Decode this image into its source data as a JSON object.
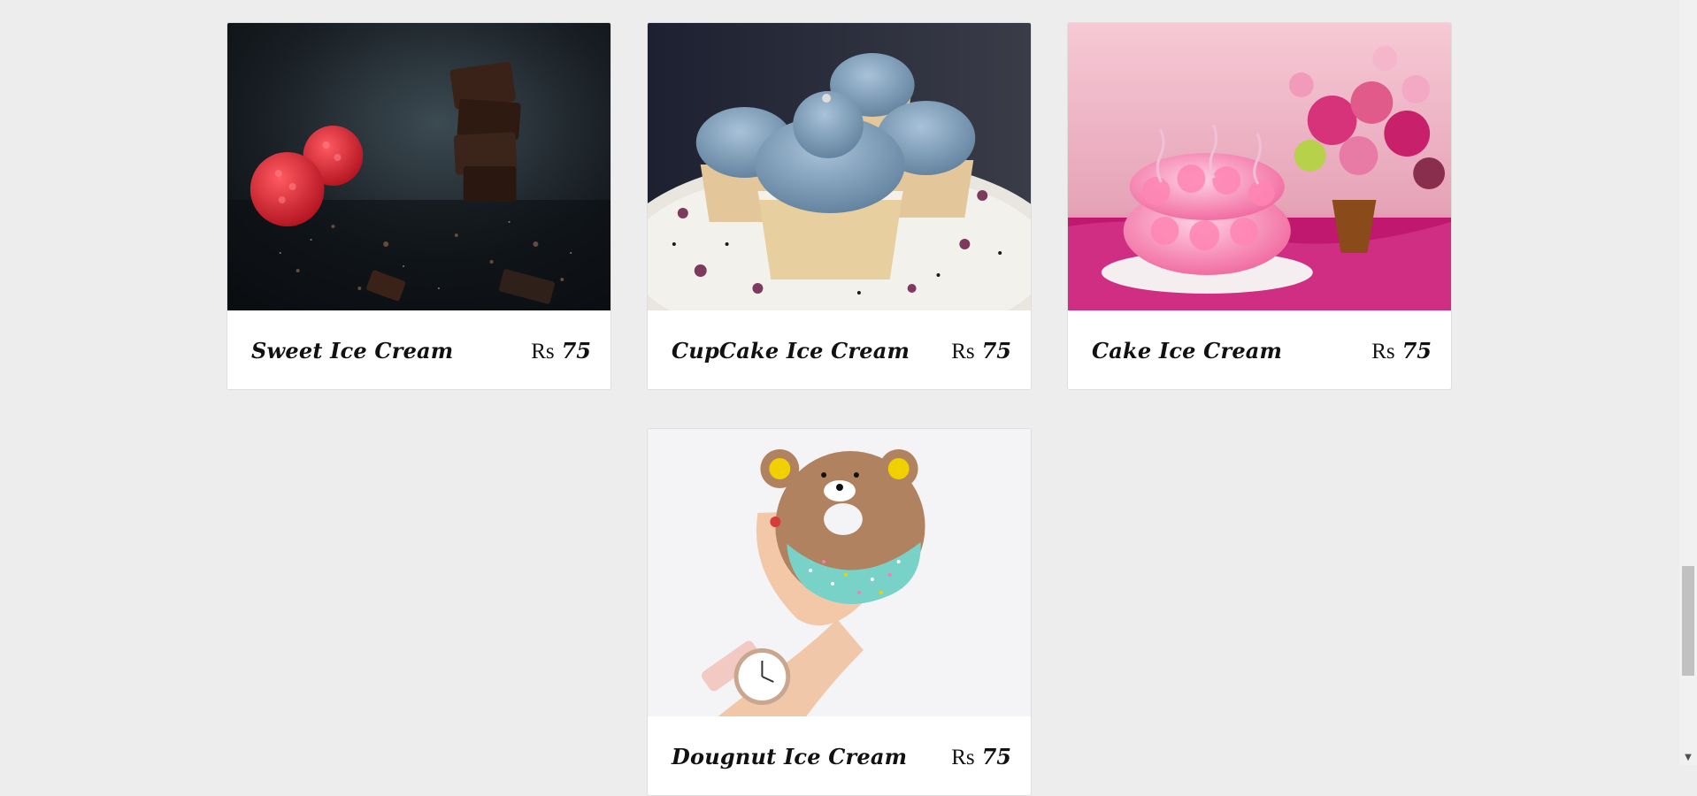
{
  "products": [
    {
      "name": "Sweet Ice Cream",
      "currency": "Rs",
      "price": "75",
      "image_icon": "chocolate-raspberry-photo"
    },
    {
      "name": "CupCake Ice Cream",
      "currency": "Rs",
      "price": "75",
      "image_icon": "blue-cupcakes-photo"
    },
    {
      "name": "Cake Ice Cream",
      "currency": "Rs",
      "price": "75",
      "image_icon": "pink-rose-cake-photo"
    },
    {
      "name": "Dougnut Ice Cream",
      "currency": "Rs",
      "price": "75",
      "image_icon": "bear-donut-photo"
    }
  ],
  "scrollbar": {
    "down_arrow_icon": "chevron-down-icon"
  }
}
